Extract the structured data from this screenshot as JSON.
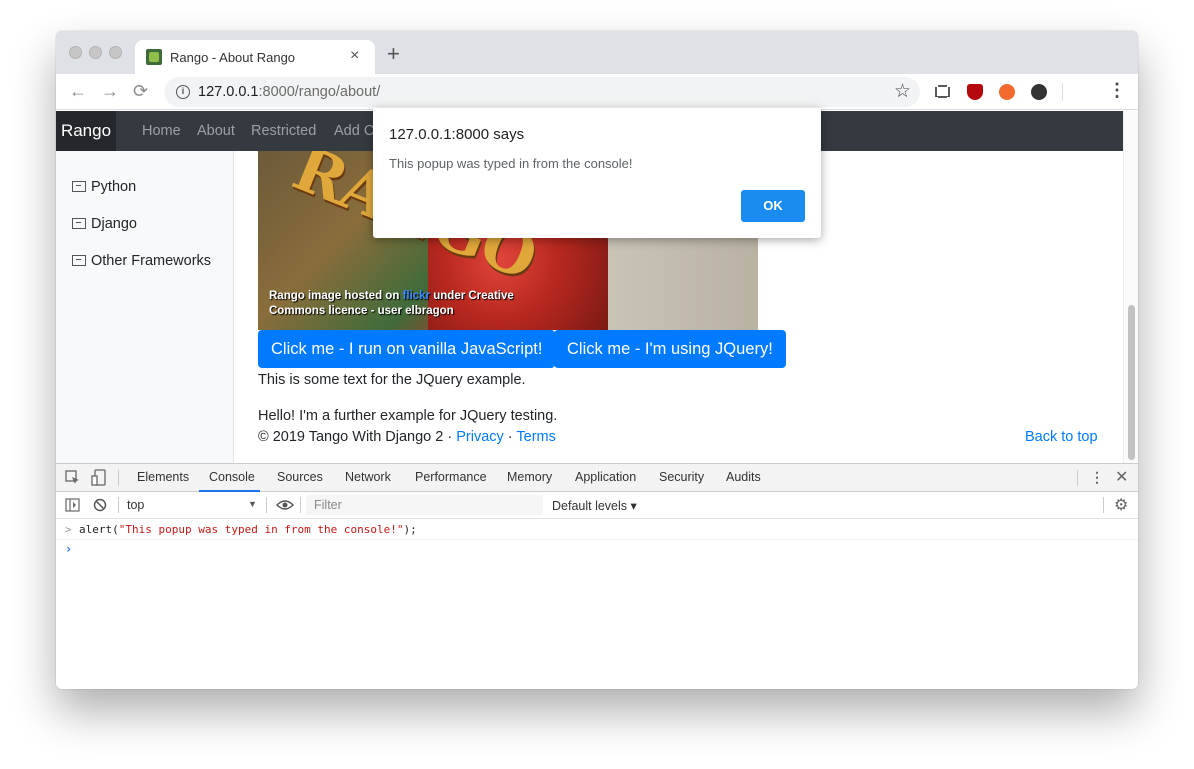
{
  "browser": {
    "tab": {
      "title": "Rango - About Rango",
      "close": "×"
    },
    "new_tab": "+",
    "nav": {
      "back": "←",
      "forward": "→",
      "reload": "⟳"
    },
    "address": {
      "host": "127.0.0.1",
      "rest": ":8000/rango/about/"
    },
    "menu": "⋮"
  },
  "page": {
    "brand": "Rango",
    "nav_links": [
      "Home",
      "About",
      "Restricted",
      "Add C"
    ],
    "sidebar": [
      "Python",
      "Django",
      "Other Frameworks"
    ],
    "image_word": "RANGO",
    "image_caption": {
      "line1_prefix": "Rango image hosted on ",
      "line1_link": "flickr",
      "line1_suffix": " under Creative",
      "line2": "Commons licence - user elbragon"
    },
    "buttons": {
      "vanilla": "Click me - I run on vanilla JavaScript!",
      "jquery": "Click me - I'm using JQuery!"
    },
    "text1": "This is some text for the JQuery example.",
    "text2": "Hello! I'm a further example for JQuery testing.",
    "footer": {
      "copyright": "© 2019 Tango With Django 2 · ",
      "privacy": "Privacy",
      "dot": " · ",
      "terms": "Terms",
      "back_to_top": "Back to top"
    }
  },
  "dialog": {
    "title": "127.0.0.1:8000 says",
    "message": "This popup was typed in from the console!",
    "ok": "OK"
  },
  "devtools": {
    "tabs": [
      "Elements",
      "Console",
      "Sources",
      "Network",
      "Performance",
      "Memory",
      "Application",
      "Security",
      "Audits"
    ],
    "active_tab": "Console",
    "context": "top",
    "filter_placeholder": "Filter",
    "levels": "Default levels ▾",
    "command_prefix": "alert(",
    "command_string": "\"This popup was typed in from the console!\"",
    "command_suffix": ");",
    "prompt": ">",
    "caret": "›"
  }
}
